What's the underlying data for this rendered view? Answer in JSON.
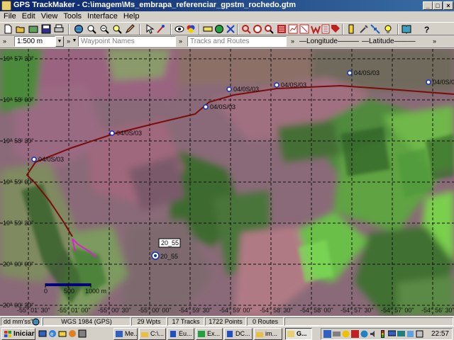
{
  "window": {
    "title": "GPS TrackMaker - C:\\imagem\\Ms_embrapa_referenciar_gpstm_rochedo.gtm",
    "minimize": "_",
    "maximize": "□",
    "close": "×"
  },
  "menu": {
    "items": [
      "File",
      "Edit",
      "View",
      "Tools",
      "Interface",
      "Help"
    ]
  },
  "toolbar2": {
    "scale_value": "1:500 m",
    "waypoint_placeholder": "Waypoint Names",
    "tracks_placeholder": "Tracks and Routes",
    "longitude_label": "Longitude",
    "latitude_label": "Latitude"
  },
  "map": {
    "lat_labels": [
      "-19° 57' 30\"",
      "-19° 58' 00\"",
      "-19° 58' 30\"",
      "-19° 59' 00\"",
      "-19° 59' 30\"",
      "-20° 00' 00\"",
      "-20° 00' 30\""
    ],
    "lon_labels": [
      "-55° 01' 30\"",
      "-55° 01' 00\"",
      "-55° 00' 30\"",
      "-55° 00' 00\"",
      "-54° 59' 30\"",
      "-54° 59' 00\"",
      "-54° 58' 30\"",
      "-54° 58' 00\"",
      "-54° 57' 30\"",
      "-54° 57' 00\"",
      "-54° 56' 30\""
    ],
    "waypoints": [
      {
        "label": "04/0S/03"
      },
      {
        "label": "04/0S/03"
      },
      {
        "label": "04/0S/03"
      },
      {
        "label": "04/0S/03"
      },
      {
        "label": "04/0S/03"
      },
      {
        "label": "04/0S/03"
      },
      {
        "label": "04/0S/03"
      }
    ],
    "tooltip": "20_55",
    "point_label": "20_55",
    "scale_bar": {
      "zero": "0",
      "mid": "500",
      "end": "1000 m"
    }
  },
  "status": {
    "units": "dd mm'ss\"",
    "datum": "WGS 1984 (GPS)",
    "waypoints": "29 Wpts",
    "tracks": "17 Tracks",
    "points": "1722 Points",
    "routes": "0 Routes"
  },
  "taskbar": {
    "start": "Iniciar",
    "tasks": [
      "Me...",
      "C:\\...",
      "Eu...",
      "Ex...",
      "DC...",
      "im...",
      "G..."
    ],
    "clock": "22:57"
  },
  "colors": {
    "track": "#7a0c0c",
    "pink_track": "#e020d0",
    "waypoint": "#1030c0",
    "grid": "#111111"
  }
}
